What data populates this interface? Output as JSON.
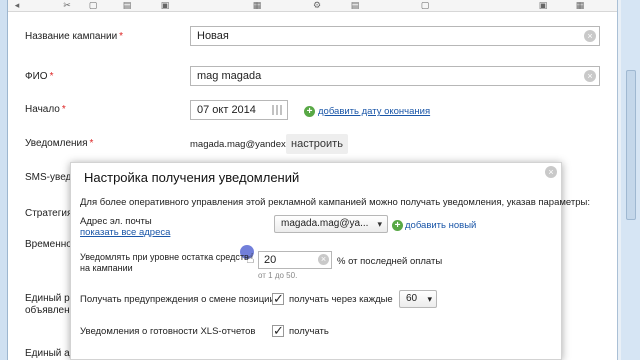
{
  "form": {
    "campaign_name": {
      "label": "Название кампании",
      "required": "*",
      "value": "Новая"
    },
    "fio": {
      "label": "ФИО",
      "required": "*",
      "value": "mag magada"
    },
    "start": {
      "label": "Начало",
      "required": "*",
      "value": "07 окт 2014",
      "add_end_date": "добавить дату окончания"
    },
    "notifications": {
      "label": "Уведомления",
      "required": "*",
      "email": "magada.mag@yandex.ru",
      "setup_button": "настроить"
    },
    "sms": {
      "label": "SMS-уведо"
    },
    "strategy": {
      "label": "Стратегия",
      "required": "*"
    },
    "time": {
      "label": "Временной"
    },
    "single_region": {
      "label_line1": "Единый рег",
      "label_line2": "объявлений"
    },
    "single_address": {
      "label": "Единый адр"
    }
  },
  "popup": {
    "title": "Настройка получения уведомлений",
    "intro": "Для более оперативного управления этой рекламной кампанией можно получать уведомления, указав параметры:",
    "email_label": "Адрес эл. почты",
    "show_all_link": "показать все адреса",
    "email_select": "magada.mag@ya...",
    "add_new": "добавить новый",
    "threshold_label_line1": "Уведомлять при уровне остатка средств",
    "threshold_label_line2": "на кампании",
    "threshold_value": "20",
    "threshold_suffix": "% от последней оплаты",
    "threshold_hint": "от 1 до 50.",
    "position_label": "Получать предупреждения о смене позиции",
    "position_checkbox_label": "получать через каждые",
    "position_interval": "60",
    "xls_label": "Уведомления о готовности XLS-отчетов",
    "xls_checkbox_label": "получать"
  },
  "icons": {
    "clear": "clear-icon",
    "calendar": "calendar-icon",
    "plus": "plus-icon",
    "close": "close-icon",
    "check": "checkmark-icon"
  },
  "colors": {
    "link": "#1a56a8",
    "required": "#dd2222",
    "add_green": "#58a845",
    "cursor_highlight": "#5968d4"
  }
}
